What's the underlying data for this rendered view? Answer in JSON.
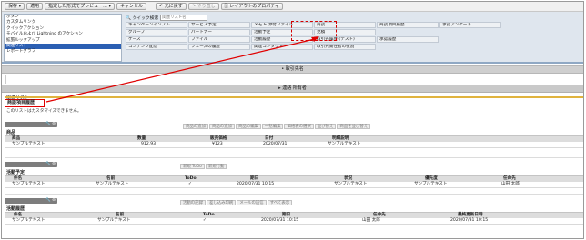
{
  "toolbar": {
    "save": "保存 ▾",
    "quicksave": "適用",
    "preview": "指定した形式でプレビュー... ▾",
    "cancel": "キャンセル",
    "undo": "↶ 元に戻す",
    "redo": "↷ やり直し",
    "layout_props": "🗎 レイアウトのプロパティ"
  },
  "palette": {
    "items": [
      "ボタン",
      "カスタムリンク",
      "クイックアクション",
      "モバイルおよび Lightning のアクション",
      "拡張ルックアップ",
      "関連リスト",
      "レポートグラフ"
    ],
    "selected_index": 5,
    "quick_find_label": "🔍 クイック検索",
    "quick_find_placeholder": "関連リスト名",
    "chips": [
      [
        "キャンペーンインフル...",
        "サービス予定",
        "メモ & 添付ファイル",
        "商談",
        "商談項目履歴",
        "承認アンケート"
      ],
      [
        "グループ",
        "パートナー",
        "活動予定",
        "見積",
        "",
        ""
      ],
      [
        "ケース",
        "ファイル",
        "活動履歴",
        "取引先履歴 (テスト)",
        "承認履歴",
        ""
      ],
      [
        "コンテンツ配信",
        "フェーズの履歴",
        "関連コンタクト",
        "取引先責任者の役割",
        "",
        ""
      ]
    ]
  },
  "main": {
    "account_name_bar": "• 取引先名",
    "owner_bar": "▸ 連絡 所有者",
    "related_list_label": "関連リスト",
    "highlight_label": "商談項目履歴",
    "highlight_note": "このリストはカスタマイズできません。",
    "products": {
      "buttons": [
        "商品の追加",
        "商品の追加",
        "商品の編集",
        "一括編集",
        "価格表の選択",
        "並び替え",
        "商品を並び替え"
      ],
      "title": "商品",
      "headers": [
        "商品",
        "数量",
        "販売価格",
        "日付",
        "明細説明"
      ],
      "row": [
        "サンプルテキスト",
        "912.93",
        "¥123",
        "2020/07/31",
        "サンプルテキスト"
      ]
    },
    "open_activities": {
      "buttons": [
        "新規 ToDo",
        "新規行動"
      ],
      "title": "活動予定",
      "headers": [
        "件名",
        "名前",
        "ToDo",
        "期日",
        "状況",
        "優先度",
        "任命先"
      ],
      "row": [
        "サンプルテキスト",
        "サンプルテキスト",
        "✓",
        "2020/07/31 10:15",
        "サンプルテキスト",
        "サンプルテキスト",
        "山田 太郎"
      ]
    },
    "activity_history": {
      "buttons": [
        "活動の記録",
        "差し込み印刷",
        "メールの送信",
        "すべて表示"
      ],
      "title": "活動履歴",
      "headers": [
        "件名",
        "名前",
        "ToDo",
        "期日",
        "任命先",
        "最終更新日時"
      ],
      "row": [
        "サンプルテキスト",
        "サンプルテキスト",
        "✓",
        "2020/07/31 10:15",
        "山田 太郎",
        "2020/07/31 10:15"
      ]
    },
    "ctl_icons": "🔧 ⊖"
  },
  "colors": {
    "annotation_red": "#e00000",
    "selected_blue": "#2b5fb3",
    "section_gold": "#e0b33e"
  }
}
